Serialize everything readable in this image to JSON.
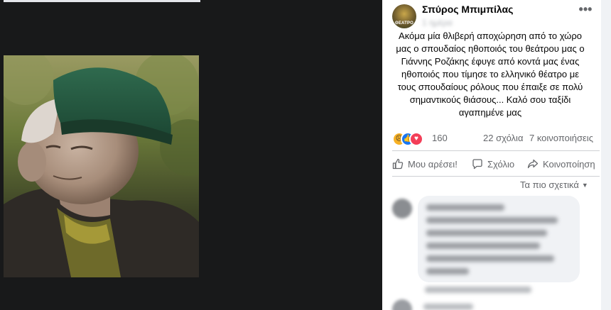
{
  "post": {
    "author": "Σπύρος Μπιμπίλας",
    "avatar_text": "ΘΕΑΤΡΟ",
    "timestamp": "1 ημέρα",
    "more_label": "•••",
    "text": "Ακόμα μία θλιβερή αποχώρηση από το χώρο μας ο σπουδαίος ηθοποιός του θεάτρου μας ο Γιάννης Ροζάκης έφυγε από κοντά μας ένας ηθοποιός που τίμησε το ελληνικό θέατρο με τους σπουδαίους ρόλους που έπαιξε σε πολύ σημαντικούς θιάσους... Καλό σου ταξίδι αγαπημένε μας"
  },
  "stats": {
    "reactions_count": "160",
    "comments": "22 σχόλια",
    "shares": "7 κοινοποιήσεις"
  },
  "actions": {
    "like": "Μου αρέσει!",
    "comment": "Σχόλιο",
    "share": "Κοινοποίηση"
  },
  "sort": {
    "label": "Τα πιο σχετικά",
    "caret": "▼"
  },
  "colors": {
    "like_blue": "#1877f2",
    "love_red": "#f33e58",
    "sad_yellow": "#f7b125",
    "secondary_text": "#65676b"
  }
}
